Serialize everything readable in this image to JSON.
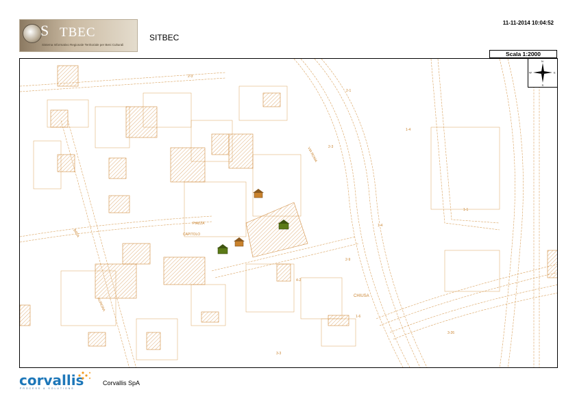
{
  "header": {
    "timestamp": "11-11-2014 10:04:52",
    "logo_main": "TBEC",
    "logo_s": "S",
    "logo_subtitle": "Sistema Informativo Regionale Territoriale per Beni Culturali",
    "app_title": "SITBEC",
    "scale_label": "Scala 1:2000"
  },
  "map": {
    "labels": [
      {
        "id": "via-roma",
        "text": "VIA ROMA"
      },
      {
        "id": "piazza",
        "text": "PIAZZA"
      },
      {
        "id": "capitolo",
        "text": "CAPITOLO"
      },
      {
        "id": "chiusa",
        "text": "CHIUSA"
      },
      {
        "id": "via-brta",
        "text": "BRTA"
      },
      {
        "id": "aurora",
        "text": "AURORA"
      },
      {
        "id": "num-1",
        "text": "2-3"
      },
      {
        "id": "num-2",
        "text": "2-1"
      },
      {
        "id": "num-3",
        "text": "1-4"
      },
      {
        "id": "num-4",
        "text": "1-4"
      },
      {
        "id": "num-5",
        "text": "1-1"
      },
      {
        "id": "num-6",
        "text": "2-3"
      },
      {
        "id": "num-7",
        "text": "1-6"
      },
      {
        "id": "num-8",
        "text": "3-26"
      },
      {
        "id": "num-9",
        "text": "2-9"
      },
      {
        "id": "num-10",
        "text": "4-2"
      },
      {
        "id": "num-11",
        "text": "3-3"
      }
    ],
    "colors": {
      "lines": "#d9a15c",
      "hatch": "#d08a3c",
      "icon_green": "#5b7a17"
    }
  },
  "compass": {
    "n": "N",
    "s": "S",
    "e": "E",
    "w": "W"
  },
  "footer": {
    "logo_word": "corvallis",
    "logo_tag": "PROCESS & SOLUTIONS",
    "company": "Corvallis SpA"
  }
}
